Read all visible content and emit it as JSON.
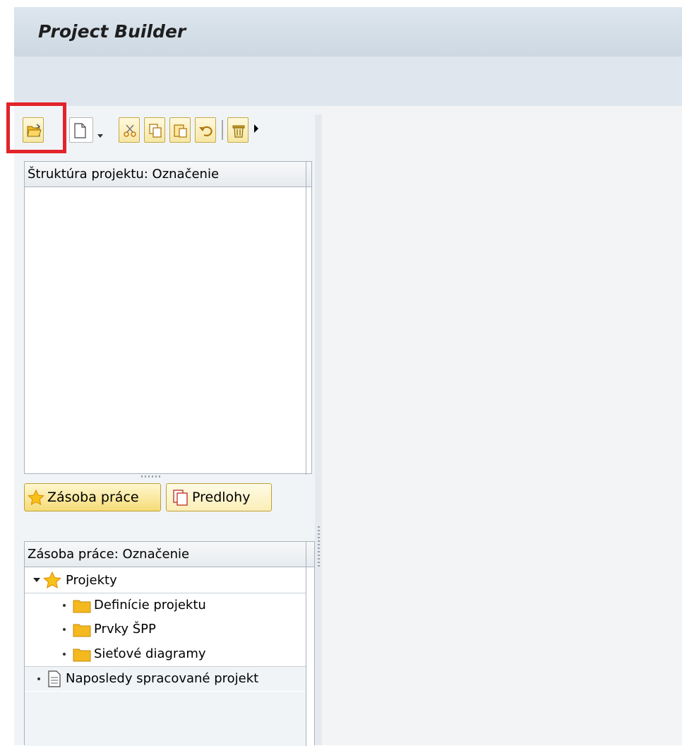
{
  "app": {
    "title": "Project Builder"
  },
  "toolbar": {
    "buttons": [
      {
        "name": "open",
        "icon": "open-folder-icon",
        "highlighted": true
      },
      {
        "name": "create",
        "icon": "new-document-icon",
        "has_dropdown": true
      },
      {
        "name": "cut",
        "icon": "scissors-icon"
      },
      {
        "name": "copy",
        "icon": "copy-icon"
      },
      {
        "name": "paste",
        "icon": "paste-icon"
      },
      {
        "name": "undo",
        "icon": "undo-icon"
      },
      {
        "name": "delete",
        "icon": "trash-icon"
      }
    ],
    "more_icon": "triangle-right-icon",
    "highlight_color": "#e2242a"
  },
  "structure_panel": {
    "header": "Štruktúra projektu: Označenie"
  },
  "tabs": [
    {
      "label": "Zásoba práce",
      "icon": "star-icon",
      "active": true
    },
    {
      "label": "Predlohy",
      "icon": "templates-icon",
      "active": false
    }
  ],
  "worklist_panel": {
    "header": "Zásoba práce: Označenie",
    "tree": {
      "root": {
        "label": "Projekty",
        "icon": "star-icon",
        "expanded": true
      },
      "children": [
        {
          "label": "Definície projektu",
          "icon": "folder-icon"
        },
        {
          "label": "Prvky ŠPP",
          "icon": "folder-icon"
        },
        {
          "label": "Sieťové diagramy",
          "icon": "folder-icon"
        }
      ],
      "recent": {
        "label": "Naposledy spracované projekt",
        "icon": "document-icon"
      }
    }
  },
  "colors": {
    "title_bar": "#dde6ee",
    "button_gold": "#f5dc76",
    "folder_yellow": "#f3b91e",
    "star_orange": "#f0a30a"
  }
}
